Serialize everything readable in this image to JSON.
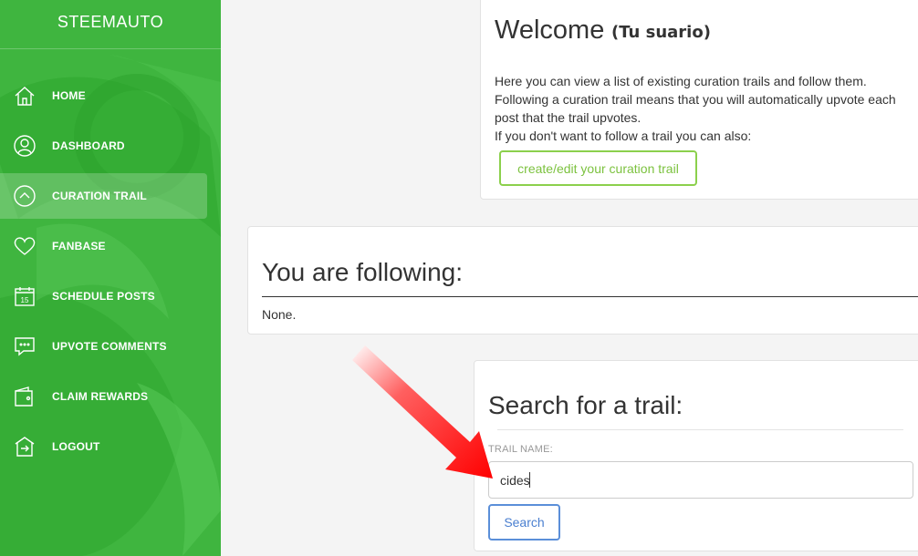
{
  "app": {
    "brand": "STEEMAUTO"
  },
  "sidebar": {
    "items": [
      {
        "label": "HOME",
        "icon": "home-icon",
        "active": false
      },
      {
        "label": "DASHBOARD",
        "icon": "user-icon",
        "active": false
      },
      {
        "label": "CURATION TRAIL",
        "icon": "chevron-up-circle-icon",
        "active": true
      },
      {
        "label": "FANBASE",
        "icon": "heart-icon",
        "active": false
      },
      {
        "label": "SCHEDULE POSTS",
        "icon": "calendar-icon",
        "active": false,
        "icon_text": "15"
      },
      {
        "label": "UPVOTE COMMENTS",
        "icon": "comment-icon",
        "active": false
      },
      {
        "label": "CLAIM REWARDS",
        "icon": "wallet-icon",
        "active": false
      },
      {
        "label": "LOGOUT",
        "icon": "logout-icon",
        "active": false
      }
    ]
  },
  "welcome": {
    "title": "Welcome",
    "user": "(Tu suario)",
    "lines": [
      "Here you can view a list of existing curation trails and follow them.",
      "Following a curation trail means that you will automatically upvote each post that the trail upvotes.",
      "If you don't want to follow a trail you can also:"
    ],
    "button_label": "create/edit your curation trail"
  },
  "following": {
    "title": "You are following:",
    "value": "None."
  },
  "search": {
    "title": "Search for a trail:",
    "field_label": "TRAIL NAME:",
    "input_value": "cides",
    "button_label": "Search"
  },
  "colors": {
    "sidebar": "#3fb53f",
    "green_button": "#8bd04c",
    "blue_button": "#5b8fd9",
    "annotation_arrow": "#ff0000"
  }
}
